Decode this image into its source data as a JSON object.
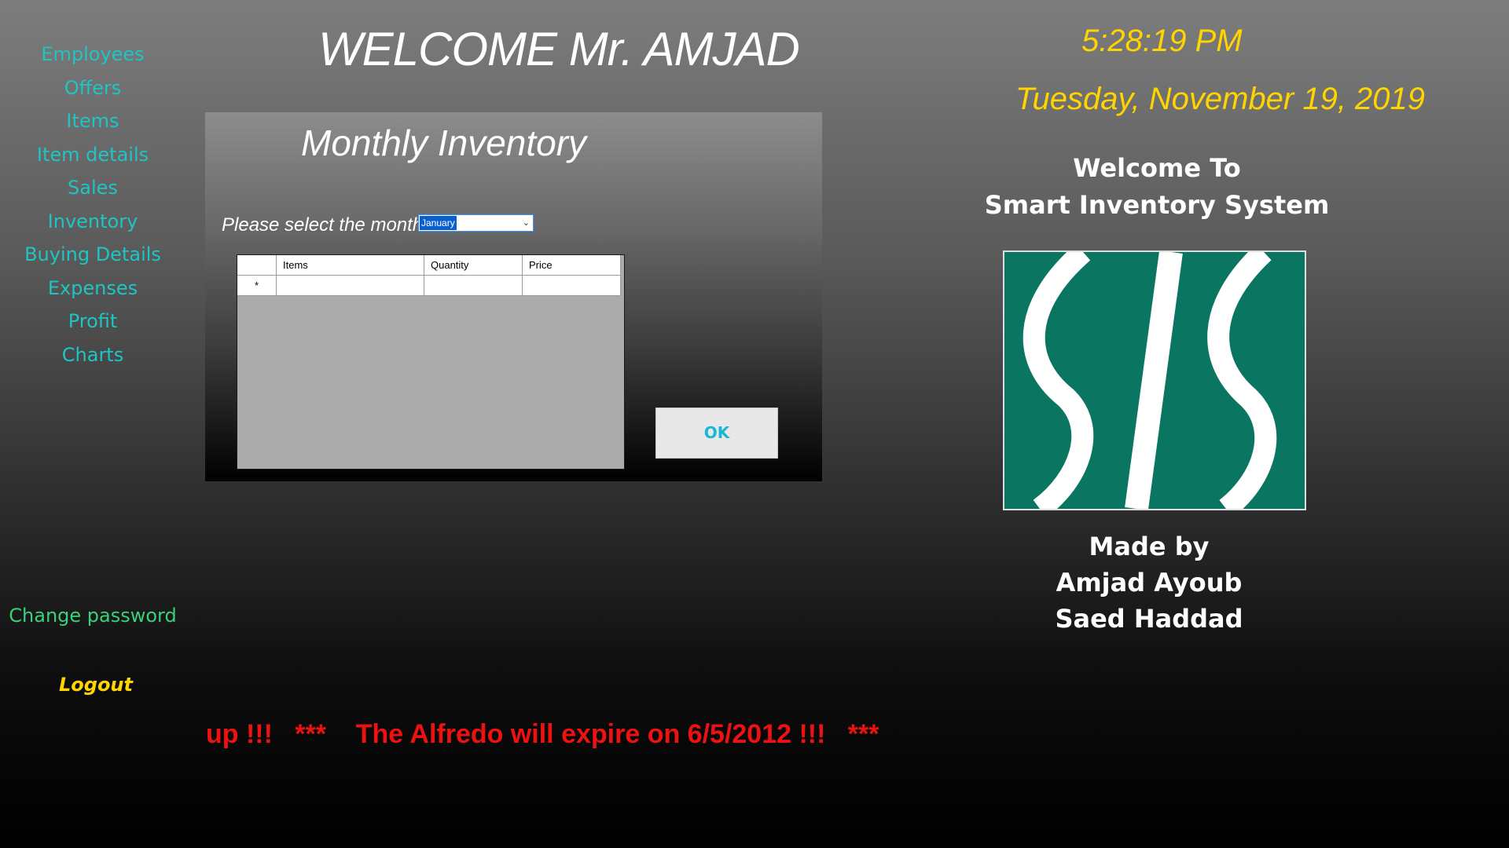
{
  "header": {
    "welcome": "WELCOME Mr. AMJAD"
  },
  "sidebar": {
    "items": [
      {
        "label": "Employees"
      },
      {
        "label": "Offers"
      },
      {
        "label": "Items"
      },
      {
        "label": "Item details"
      },
      {
        "label": "Sales"
      },
      {
        "label": "Inventory"
      },
      {
        "label": "Buying Details"
      },
      {
        "label": "Expenses"
      },
      {
        "label": "Profit"
      },
      {
        "label": "Charts"
      }
    ],
    "change_password": "Change password",
    "logout": "Logout"
  },
  "panel": {
    "title": "Monthly Inventory",
    "month_label": "Please select the month",
    "month_selected": "January",
    "ok_label": "OK",
    "grid": {
      "columns": [
        "",
        "Items",
        "Quantity",
        "Price"
      ],
      "new_row_marker": "*"
    }
  },
  "status": {
    "time": "5:28:19 PM",
    "date": "Tuesday, November 19, 2019"
  },
  "branding": {
    "welcome_line1": "Welcome To",
    "welcome_line2": "Smart Inventory System",
    "logo_icon": "sis-logo-icon",
    "logo_color": "#0a7662",
    "made_by": "Made by",
    "author1": "Amjad Ayoub",
    "author2": "Saed Haddad"
  },
  "ticker": {
    "text": "up !!!   ***    The Alfredo will expire on 6/5/2012 !!!   ***"
  },
  "colors": {
    "nav": "#1fc4c4",
    "change_password": "#3ad07a",
    "accent_yellow": "#ffd400",
    "ticker_red": "#ee1111"
  }
}
